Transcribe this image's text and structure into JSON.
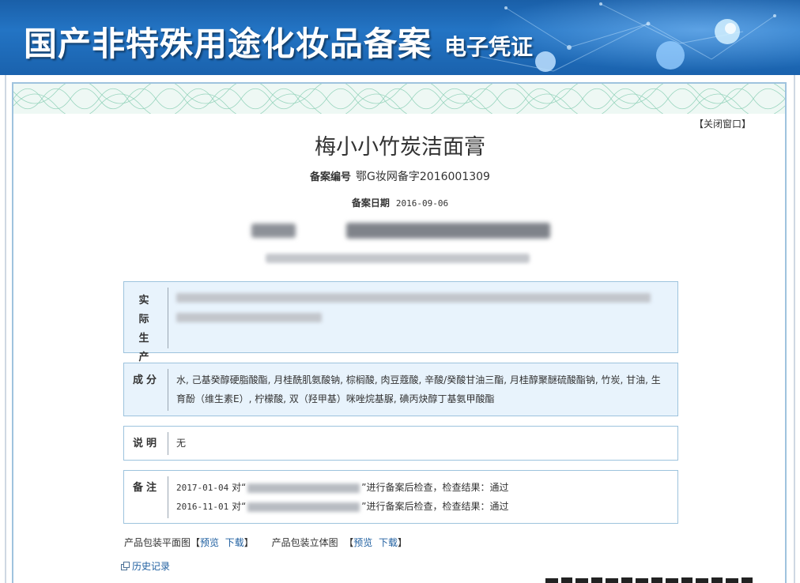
{
  "banner": {
    "title": "国产非特殊用途化妆品备案",
    "subtitle": "电子凭证"
  },
  "close_window": "【关闭窗口】",
  "product": {
    "name": "梅小小竹炭洁面膏",
    "reg_label": "备案编号",
    "reg_value": "鄂G妆网备字2016001309",
    "date_label": "备案日期",
    "date_value": "2016-09-06"
  },
  "sections": {
    "actual_producer": {
      "label": "实际生产企业"
    },
    "ingredients": {
      "label": "成分",
      "text": "水, 己基癸醇硬脂酸酯, 月桂酰肌氨酸钠, 棕榈酸, 肉豆蔻酸, 辛酸/癸酸甘油三酯, 月桂醇聚醚硫酸酯钠, 竹炭, 甘油, 生育酚（维生素E）, 柠檬酸, 双（羟甲基）咪唑烷基脲, 碘丙炔醇丁基氨甲酸酯"
    },
    "description": {
      "label": "说明",
      "text": "无"
    },
    "notes": {
      "label": "备注",
      "entries": [
        {
          "date": "2017-01-04",
          "prefix": "对“",
          "suffix": "”进行备案后检查，检查结果：通过"
        },
        {
          "date": "2016-11-01",
          "prefix": "对“",
          "suffix": "”进行备案后检查，检查结果：通过"
        }
      ]
    }
  },
  "packaging": {
    "flat_label": "产品包装平面图",
    "solid_label": "产品包装立体图",
    "bracket_open": "【",
    "bracket_close": "】",
    "preview": "预览",
    "download": "下载"
  },
  "history": {
    "label": "历史记录"
  },
  "colors": {
    "banner": "#2374c4",
    "box_border": "#9dc3dd",
    "box_fill": "#e8f3fc",
    "link": "#1f5fa0"
  }
}
